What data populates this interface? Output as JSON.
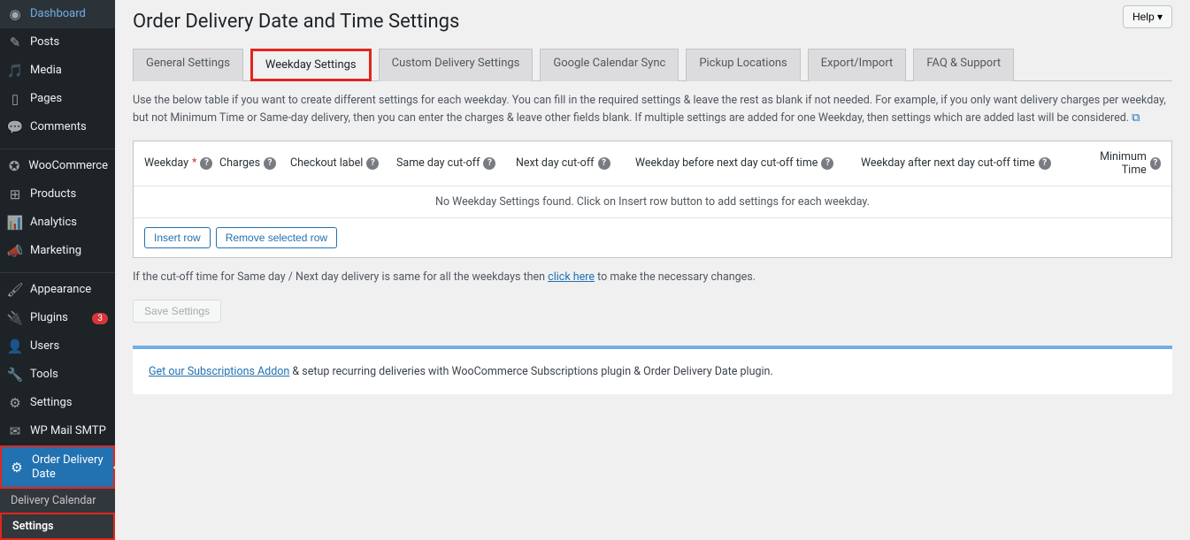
{
  "header": {
    "help": "Help ▾",
    "page_title": "Order Delivery Date and Time Settings"
  },
  "sidebar": {
    "items": [
      {
        "icon": "◉",
        "label": "Dashboard"
      },
      {
        "icon": "✎",
        "label": "Posts"
      },
      {
        "icon": "🎵",
        "label": "Media"
      },
      {
        "icon": "▯",
        "label": "Pages"
      },
      {
        "icon": "💬",
        "label": "Comments"
      },
      {
        "sep": true
      },
      {
        "icon": "✪",
        "label": "WooCommerce"
      },
      {
        "icon": "⊞",
        "label": "Products"
      },
      {
        "icon": "📊",
        "label": "Analytics"
      },
      {
        "icon": "📣",
        "label": "Marketing"
      },
      {
        "sep": true
      },
      {
        "icon": "🖌",
        "label": "Appearance"
      },
      {
        "icon": "🔌",
        "label": "Plugins",
        "badge": "3"
      },
      {
        "icon": "👤",
        "label": "Users"
      },
      {
        "icon": "🔧",
        "label": "Tools"
      },
      {
        "icon": "⚙",
        "label": "Settings"
      },
      {
        "icon": "✉",
        "label": "WP Mail SMTP"
      },
      {
        "icon": "⚙",
        "label": "Order Delivery Date",
        "current": true
      }
    ],
    "submenu": [
      {
        "label": "Delivery Calendar"
      },
      {
        "label": "Settings",
        "current": true
      }
    ]
  },
  "tabs": [
    {
      "label": "General Settings"
    },
    {
      "label": "Weekday Settings",
      "active": true
    },
    {
      "label": "Custom Delivery Settings"
    },
    {
      "label": "Google Calendar Sync"
    },
    {
      "label": "Pickup Locations"
    },
    {
      "label": "Export/Import"
    },
    {
      "label": "FAQ & Support"
    }
  ],
  "description": "Use the below table if you want to create different settings for each weekday. You can fill in the required settings & leave the rest as blank if not needed. For example, if you only want delivery charges per weekday, but not Minimum Time or Same-day delivery, then you can enter the charges & leave other fields blank. If multiple settings are added for one Weekday, then settings which are added last will be considered.",
  "table": {
    "headers": {
      "weekday": "Weekday",
      "charges": "Charges",
      "checkout_label": "Checkout label",
      "same_day": "Same day cut-off",
      "next_day": "Next day cut-off",
      "weekday_before": "Weekday before next day cut-off time",
      "weekday_after": "Weekday after next day cut-off time",
      "min_time": "Minimum Time"
    },
    "empty_message": "No Weekday Settings found. Click on Insert row button to add settings for each weekday.",
    "insert_row": "Insert row",
    "remove_row": "Remove selected row"
  },
  "note": {
    "prefix": "If the cut-off time for Same day / Next day delivery is same for all the weekdays then ",
    "link": "click here",
    "suffix": " to make the necessary changes."
  },
  "save_button": "Save Settings",
  "promo": {
    "link": "Get our Subscriptions Addon",
    "text": " & setup recurring deliveries with WooCommerce Subscriptions plugin & Order Delivery Date plugin."
  }
}
